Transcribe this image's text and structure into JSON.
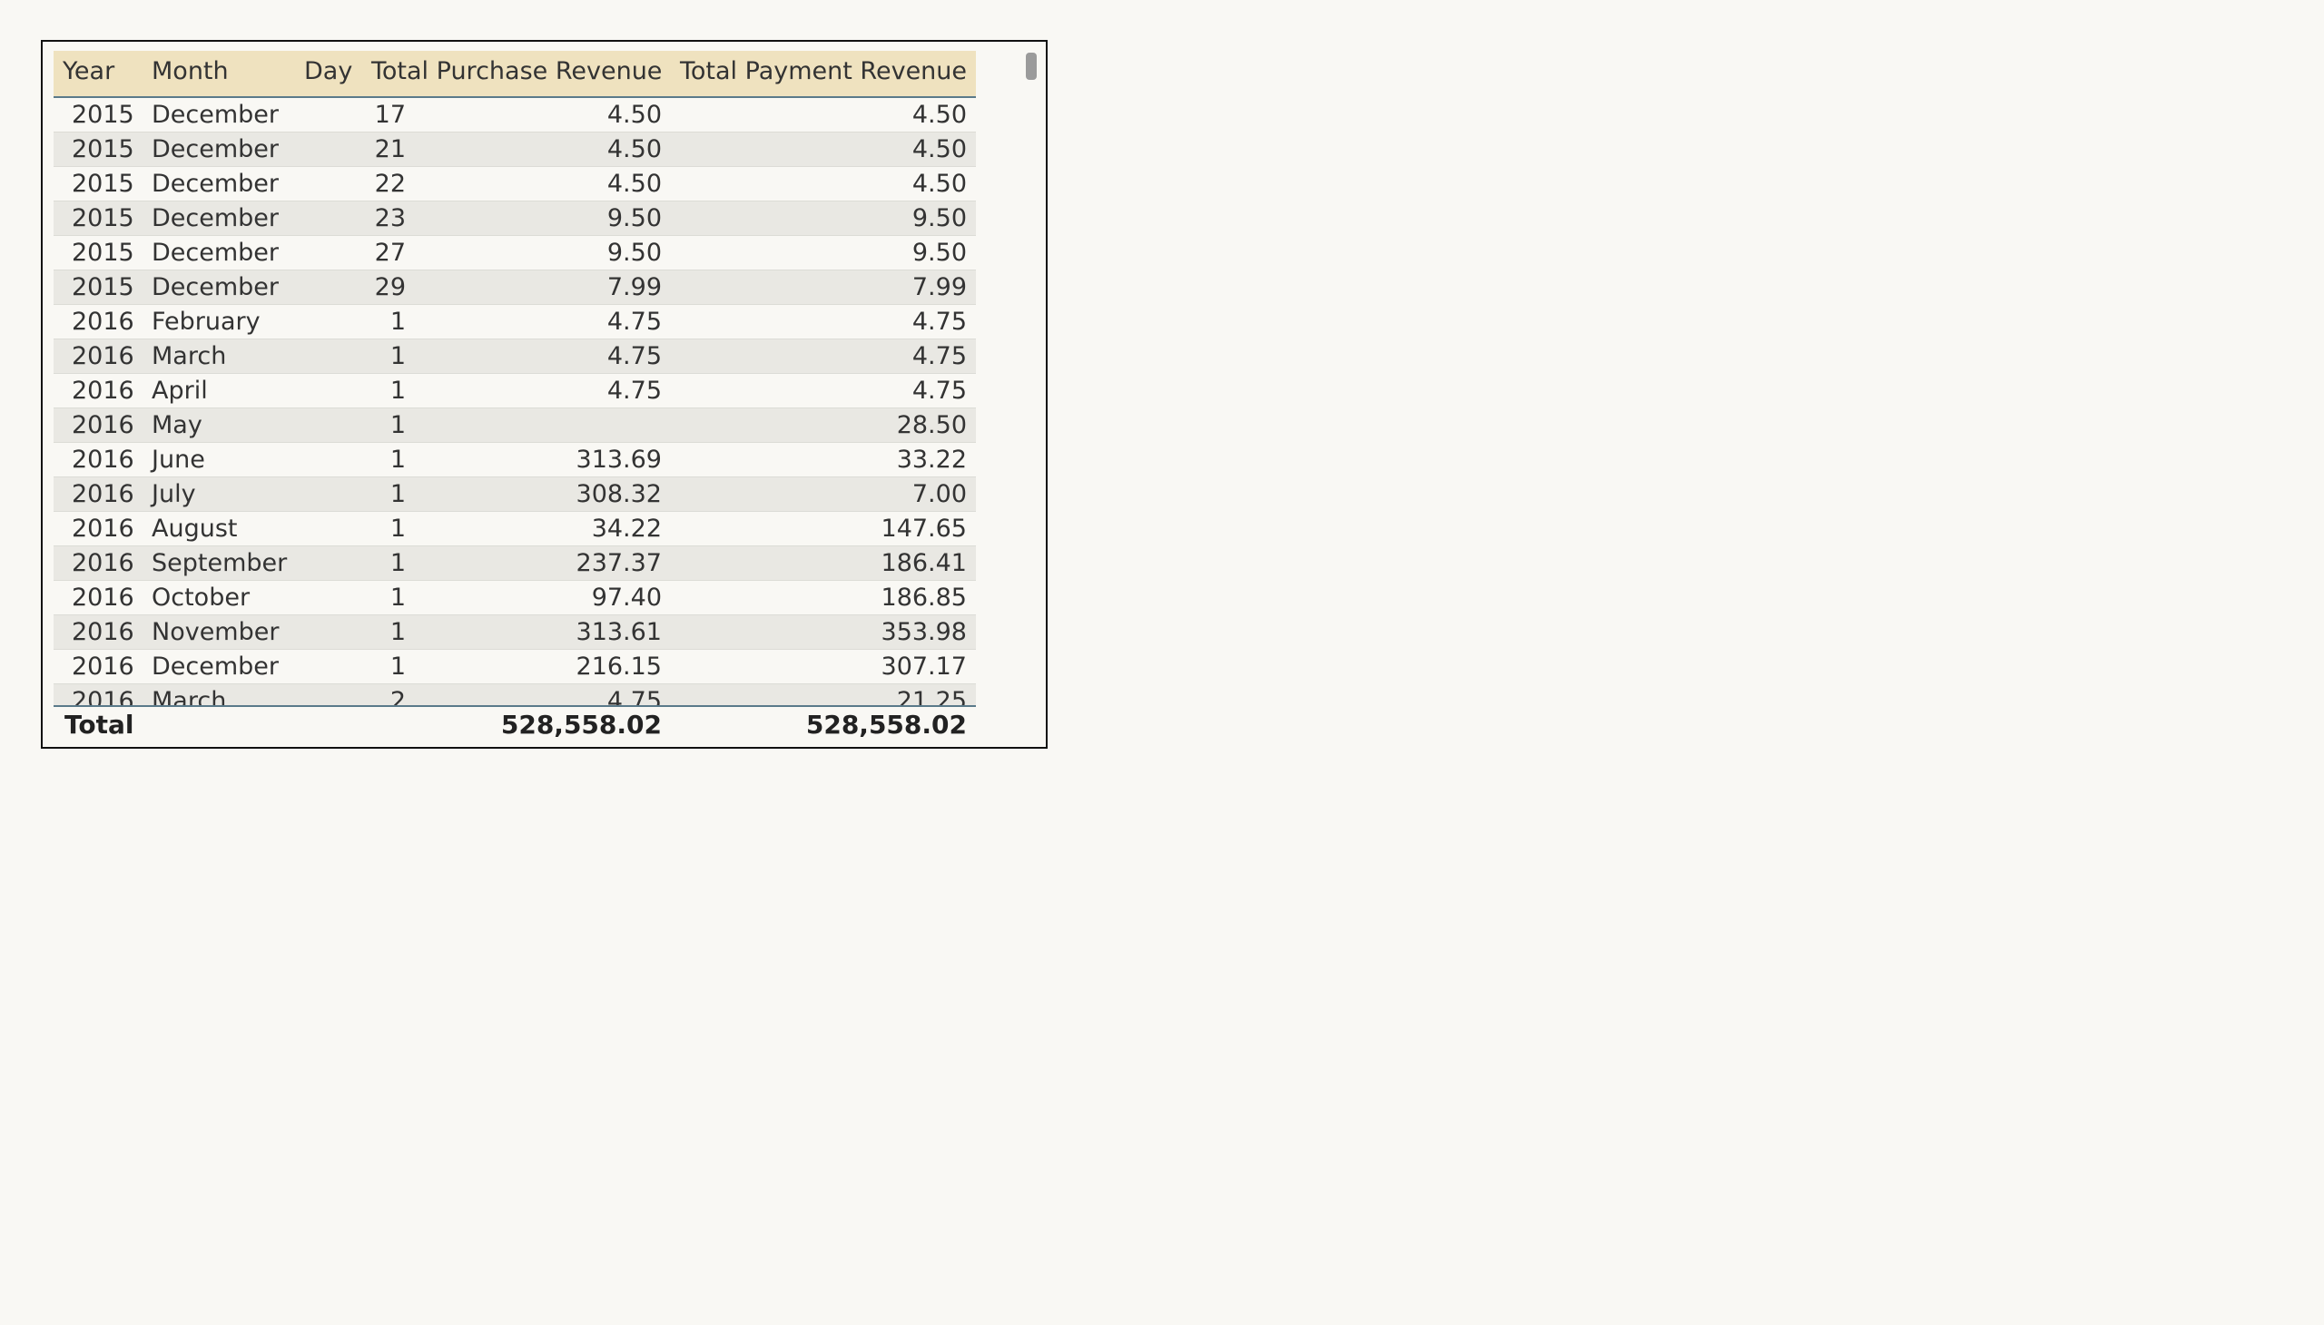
{
  "table": {
    "columns": [
      "Year",
      "Month",
      "Day",
      "Total Purchase Revenue",
      "Total Payment Revenue"
    ],
    "rows": [
      [
        "2015",
        "December",
        "17",
        "4.50",
        "4.50"
      ],
      [
        "2015",
        "December",
        "21",
        "4.50",
        "4.50"
      ],
      [
        "2015",
        "December",
        "22",
        "4.50",
        "4.50"
      ],
      [
        "2015",
        "December",
        "23",
        "9.50",
        "9.50"
      ],
      [
        "2015",
        "December",
        "27",
        "9.50",
        "9.50"
      ],
      [
        "2015",
        "December",
        "29",
        "7.99",
        "7.99"
      ],
      [
        "2016",
        "February",
        "1",
        "4.75",
        "4.75"
      ],
      [
        "2016",
        "March",
        "1",
        "4.75",
        "4.75"
      ],
      [
        "2016",
        "April",
        "1",
        "4.75",
        "4.75"
      ],
      [
        "2016",
        "May",
        "1",
        "",
        "28.50"
      ],
      [
        "2016",
        "June",
        "1",
        "313.69",
        "33.22"
      ],
      [
        "2016",
        "July",
        "1",
        "308.32",
        "7.00"
      ],
      [
        "2016",
        "August",
        "1",
        "34.22",
        "147.65"
      ],
      [
        "2016",
        "September",
        "1",
        "237.37",
        "186.41"
      ],
      [
        "2016",
        "October",
        "1",
        "97.40",
        "186.85"
      ],
      [
        "2016",
        "November",
        "1",
        "313.61",
        "353.98"
      ],
      [
        "2016",
        "December",
        "1",
        "216.15",
        "307.17"
      ],
      [
        "2016",
        "March",
        "2",
        "4.75",
        "21.25"
      ]
    ],
    "total": {
      "label": "Total",
      "purchase": "528,558.02",
      "payment": "528,558.02"
    }
  },
  "colors": {
    "header_bg": "#efe2bf",
    "row_alt_bg": "#e9e8e3",
    "border": "#5a7a8a"
  }
}
